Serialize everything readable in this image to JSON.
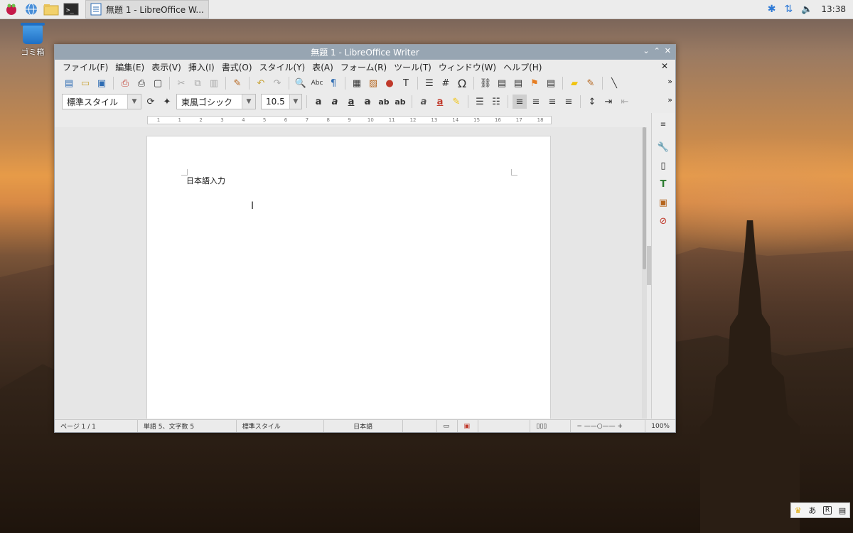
{
  "panel": {
    "task_label": "無題 1 - LibreOffice W...",
    "clock": "13:38"
  },
  "desktop": {
    "trash_label": "ゴミ箱"
  },
  "window": {
    "title": "無題 1 - LibreOffice Writer",
    "menu": [
      "ファイル(F)",
      "編集(E)",
      "表示(V)",
      "挿入(I)",
      "書式(O)",
      "スタイル(Y)",
      "表(A)",
      "フォーム(R)",
      "ツール(T)",
      "ウィンドウ(W)",
      "ヘルプ(H)"
    ],
    "paragraph_style": "標準スタイル",
    "font_name": "東風ゴシック",
    "font_size": "10.5",
    "ruler_marks": [
      "1",
      "1",
      "2",
      "3",
      "4",
      "5",
      "6",
      "7",
      "8",
      "9",
      "10",
      "11",
      "12",
      "13",
      "14",
      "15",
      "16",
      "17",
      "18"
    ],
    "document_text": "日本語入力",
    "status": {
      "page": "ページ 1 / 1",
      "words": "単語 5、文字数 5",
      "style": "標準スタイル",
      "language": "日本語",
      "zoom": "100%"
    }
  },
  "ime": {
    "mode": "あ",
    "reg": "R"
  }
}
